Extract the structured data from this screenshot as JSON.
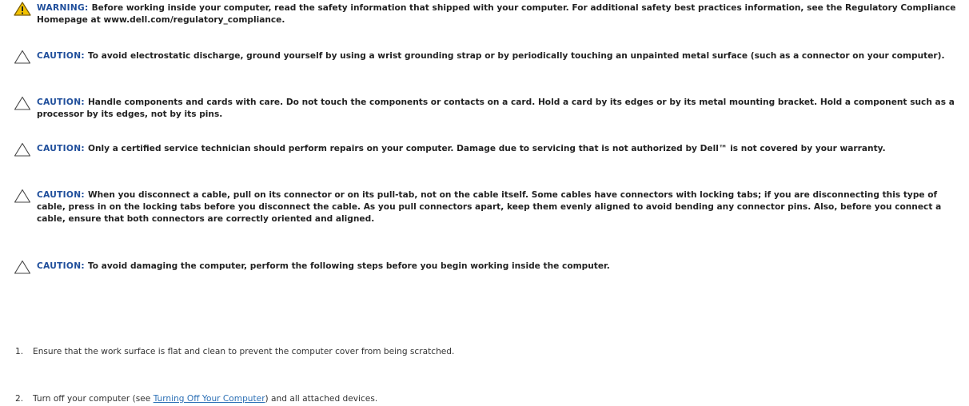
{
  "colors": {
    "label": "#1F4E9B",
    "link": "#2B6FB5",
    "warning_icon": "#F2C200",
    "caution_icon": "#444444"
  },
  "notices": [
    {
      "kind": "warning",
      "icon": "warning-triangle-icon",
      "label": "WARNING:",
      "text": "Before working inside your computer, read the safety information that shipped with your computer. For additional safety best practices information, see the Regulatory Compliance Homepage at www.dell.com/regulatory_compliance."
    },
    {
      "kind": "caution",
      "icon": "caution-triangle-icon",
      "label": "CAUTION:",
      "text": "To avoid electrostatic discharge, ground yourself by using a wrist grounding strap or by periodically touching an unpainted metal surface (such as a connector on your computer)."
    },
    {
      "kind": "caution",
      "icon": "caution-triangle-icon",
      "label": "CAUTION:",
      "text": "Handle components and cards with care. Do not touch the components or contacts on a card. Hold a card by its edges or by its metal mounting bracket. Hold a component such as a processor by its edges, not by its pins."
    },
    {
      "kind": "caution",
      "icon": "caution-triangle-icon",
      "label": "CAUTION:",
      "text": "Only a certified service technician should perform repairs on your computer. Damage due to servicing that is not authorized by Dell™ is not covered by your warranty."
    },
    {
      "kind": "caution",
      "icon": "caution-triangle-icon",
      "label": "CAUTION:",
      "text": "When you disconnect a cable, pull on its connector or on its pull-tab, not on the cable itself. Some cables have connectors with locking tabs; if you are disconnecting this type of cable, press in on the locking tabs before you disconnect the cable. As you pull connectors apart, keep them evenly aligned to avoid bending any connector pins. Also, before you connect a cable, ensure that both connectors are correctly oriented and aligned."
    },
    {
      "kind": "caution",
      "icon": "caution-triangle-icon",
      "label": "CAUTION:",
      "text": "To avoid damaging the computer, perform the following steps before you begin working inside the computer."
    }
  ],
  "steps": [
    {
      "number": "1.",
      "text": "Ensure that the work surface is flat and clean to prevent the computer cover from being scratched."
    },
    {
      "number": "2.",
      "text_before": "Turn off your computer (see ",
      "link": "Turning Off Your Computer",
      "text_after": ") and all attached devices."
    }
  ]
}
